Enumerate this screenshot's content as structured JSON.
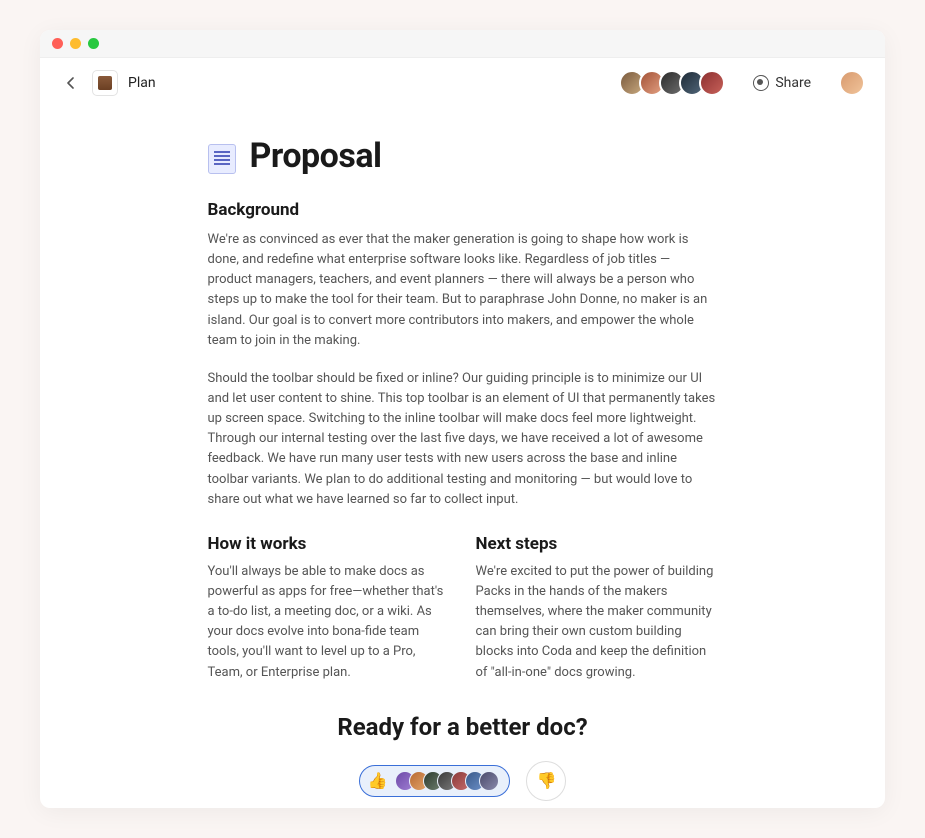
{
  "breadcrumb": {
    "label": "Plan"
  },
  "header": {
    "share_label": "Share"
  },
  "document": {
    "title": "Proposal",
    "background": {
      "heading": "Background",
      "p1": "We're as convinced as ever that the maker generation is going to shape how work is done, and redefine what enterprise software looks like. Regardless of job titles — product managers, teachers, and event planners — there will always be a person who steps up to make the tool for their team. But to paraphrase John Donne, no maker is an island. Our goal is to convert more contributors into makers, and empower the whole team to join in the making.",
      "p2": "Should the toolbar should be fixed or inline? Our guiding principle is to minimize our UI and let user content to shine. This top toolbar is an element of UI that permanently takes up screen space. Switching to the inline toolbar will make docs feel more lightweight. Through our internal testing over the last five days, we have received a lot of awesome feedback. We have run many user tests with new users across the base and inline toolbar variants. We plan to do additional testing and monitoring — but would love to share out what we have learned so far to collect input."
    },
    "how_it_works": {
      "heading": "How it works",
      "body": "You'll always be able to make docs as powerful as apps for free—whether that's a to-do list, a meeting doc, or a wiki. As your docs evolve into bona-fide team tools, you'll want to level up to a Pro, Team, or Enterprise plan."
    },
    "next_steps": {
      "heading": "Next steps",
      "body": "We're excited to put the power of building Packs in the hands of the makers themselves, where the maker community can bring their own custom building blocks into Coda and keep the definition of \"all-in-one\" docs growing."
    },
    "cta": {
      "title": "Ready for a better doc?"
    }
  }
}
